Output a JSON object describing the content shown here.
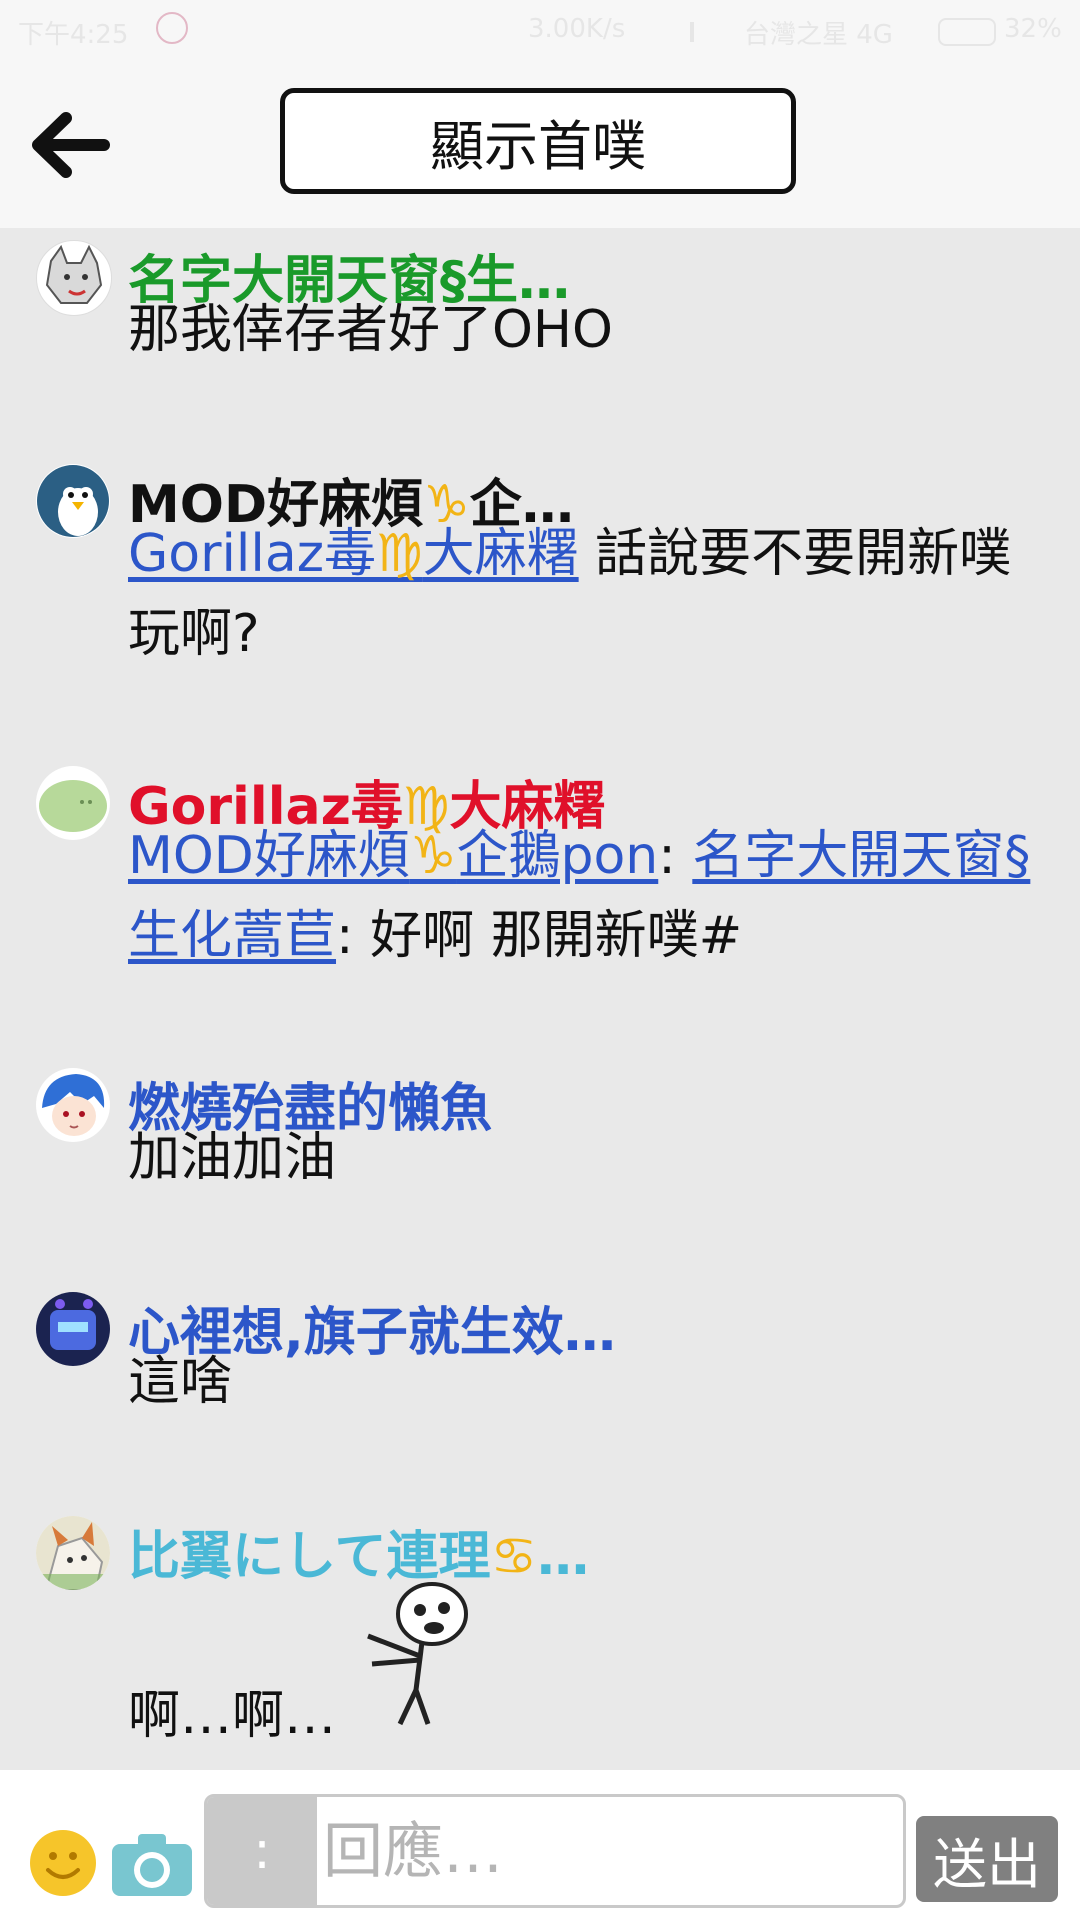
{
  "status_bar": {
    "time": "下午4:25",
    "speed": "3.00K/s",
    "carrier": "台灣之星 4G",
    "battery": "32%"
  },
  "header": {
    "back_icon": "arrow-left-icon",
    "title": "顯示首噗"
  },
  "posts": [
    {
      "name": "名字大開天窗§生…",
      "name_color": "#1a9a2a",
      "message": "那我倖存者好了OHO"
    },
    {
      "name_a": "MOD好麻煩",
      "name_sign": "♑",
      "name_b": "企…",
      "name_color": "#111111",
      "mention_a": "Gorillaz毒",
      "mention_sign": "♍",
      "mention_b": "大麻糬",
      "message": " 話說要不要開新噗玩啊?"
    },
    {
      "name_a": "Gorillaz毒",
      "name_sign": "♍",
      "name_b": "大麻糬",
      "name_color": "#e0102a",
      "mention1_a": "MOD好麻煩",
      "mention1_sign": "♑",
      "mention1_b": "企鵝pon",
      "sep1": ": ",
      "mention2": "名字大開天窗§生化蒿苣",
      "message": ": 好啊 那開新噗#"
    },
    {
      "name": "燃燒殆盡的懶魚",
      "name_color": "#2c56c9",
      "message": "加油加油"
    },
    {
      "name": "心裡想,旗子就生效…",
      "name_color": "#2c56c9",
      "message": "這啥"
    },
    {
      "name_a": "比翼にして連理",
      "name_sign": "♋",
      "name_b": "…",
      "name_color": "#4ab8d6",
      "message": "啊…啊…"
    }
  ],
  "composer": {
    "emoji_icon": "smiley-icon",
    "camera_icon": "camera-icon",
    "colon_label": ":",
    "placeholder": "回應…",
    "send_label": "送出"
  }
}
